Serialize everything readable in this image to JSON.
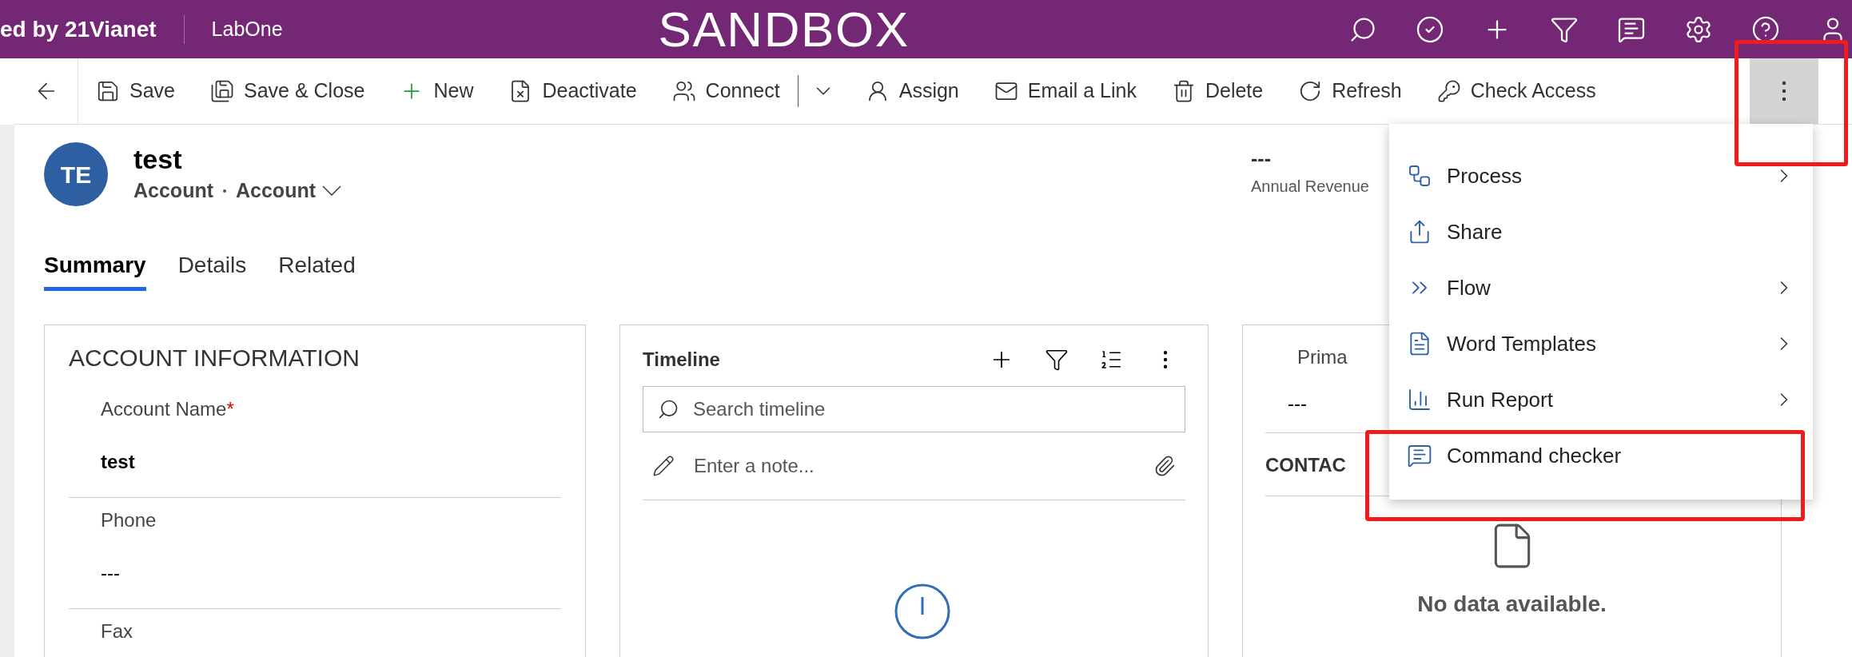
{
  "top_bar": {
    "org_text": "ed by 21Vianet",
    "app_name": "LabOne",
    "environment": "SANDBOX"
  },
  "command_bar": {
    "items": [
      {
        "label": "Save",
        "kind": "save"
      },
      {
        "label": "Save & Close",
        "kind": "save_close"
      },
      {
        "label": "New",
        "kind": "new"
      },
      {
        "label": "Deactivate",
        "kind": "deactivate"
      },
      {
        "label": "Connect",
        "kind": "connect"
      },
      {
        "label": "Assign",
        "kind": "assign"
      },
      {
        "label": "Email a Link",
        "kind": "email"
      },
      {
        "label": "Delete",
        "kind": "delete"
      },
      {
        "label": "Refresh",
        "kind": "refresh"
      },
      {
        "label": "Check Access",
        "kind": "check_access"
      }
    ]
  },
  "record": {
    "initials": "TE",
    "name": "test",
    "entity": "Account",
    "form": "Account"
  },
  "header_fields": [
    {
      "value": "---",
      "label": "Annual Revenue"
    }
  ],
  "tabs": [
    {
      "label": "Summary",
      "selected": true
    },
    {
      "label": "Details",
      "selected": false
    },
    {
      "label": "Related",
      "selected": false
    }
  ],
  "account_information": {
    "title": "ACCOUNT INFORMATION",
    "fields": [
      {
        "label": "Account Name",
        "required_mark": "*",
        "value": "test"
      },
      {
        "label": "Phone",
        "value": "---"
      },
      {
        "label": "Fax"
      }
    ]
  },
  "timeline": {
    "title": "Timeline",
    "search": {
      "placeholder": "Search timeline"
    },
    "note": {
      "placeholder": "Enter a note..."
    }
  },
  "side_panel": {
    "field_label": "Prima",
    "field_value": "---",
    "section_title": "CONTAC",
    "empty_message": "No data available."
  },
  "more_menu": {
    "items": [
      {
        "label": "Process",
        "kind": "process",
        "submenu": true
      },
      {
        "label": "Share",
        "kind": "share",
        "submenu": false
      },
      {
        "label": "Flow",
        "kind": "flow",
        "submenu": true
      },
      {
        "label": "Word Templates",
        "kind": "word",
        "submenu": true
      },
      {
        "label": "Run Report",
        "kind": "report",
        "submenu": true
      },
      {
        "label": "Command checker",
        "kind": "checker",
        "submenu": false
      }
    ]
  }
}
